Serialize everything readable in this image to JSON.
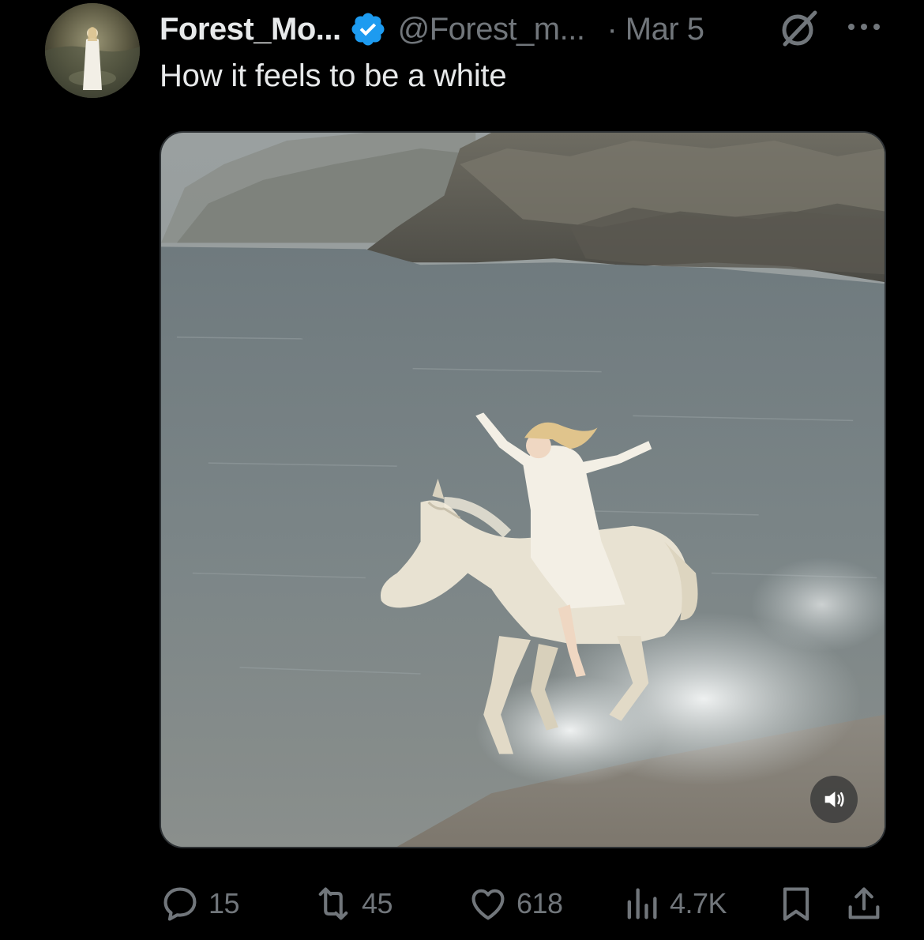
{
  "post": {
    "display_name": "Forest_Mo...",
    "handle": "@Forest_m...",
    "separator": "·",
    "date": "Mar 5",
    "text": "How it feels to be a white",
    "verified": true,
    "accent_color": "#1d9bf0"
  },
  "icons": {
    "avatar": "profile-avatar",
    "verified": "verified-badge-icon",
    "grok": "grok-icon",
    "more": "more-dots-icon",
    "sound": "volume-icon",
    "reply": "reply-icon",
    "retweet": "retweet-icon",
    "like": "heart-icon",
    "views": "views-icon",
    "bookmark": "bookmark-icon",
    "share": "share-icon"
  },
  "actions": {
    "reply_count": "15",
    "retweet_count": "45",
    "like_count": "618",
    "views_count": "4.7K"
  }
}
